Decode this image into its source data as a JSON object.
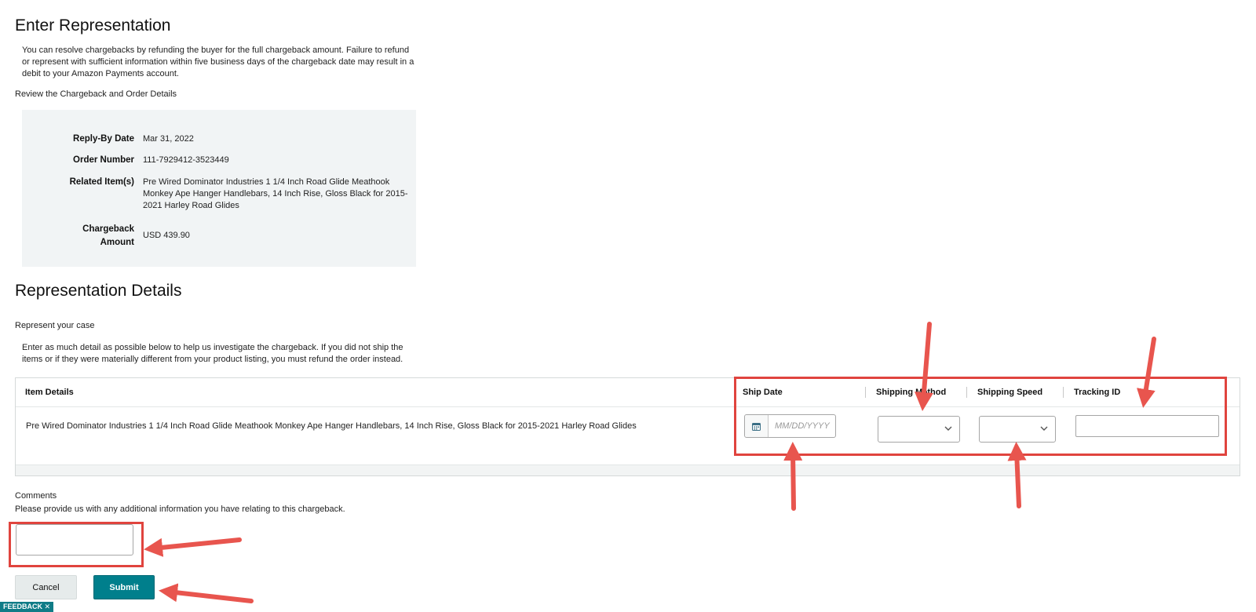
{
  "page_title": "Enter Representation",
  "intro_text": "You can resolve chargebacks by refunding the buyer for the full chargeback amount. Failure to refund or represent with sufficient information within five business days of the chargeback date may result in a debit to your Amazon Payments account.",
  "review_label": "Review the Chargeback and Order Details",
  "details": {
    "reply_by": {
      "label": "Reply-By Date",
      "value": "Mar 31, 2022"
    },
    "order_number": {
      "label": "Order Number",
      "value": "111-7929412-3523449"
    },
    "related_items": {
      "label": "Related Item(s)",
      "value": "Pre Wired Dominator Industries 1 1/4 Inch Road Glide Meathook Monkey Ape Hanger Handlebars, 14 Inch Rise, Gloss Black for 2015-2021 Harley Road Glides"
    },
    "chargeback_amount": {
      "label_line1": "Chargeback",
      "label_line2": "Amount",
      "value": "USD 439.90"
    }
  },
  "section2_title": "Representation Details",
  "represent_label": "Represent your case",
  "enter_detail_text": "Enter as much detail as possible below to help us investigate the chargeback. If you did not ship the items or if they were materially different from your product listing, you must refund the order instead.",
  "table": {
    "headers": {
      "item_details": "Item Details",
      "ship_date": "Ship Date",
      "shipping_method": "Shipping Method",
      "shipping_speed": "Shipping Speed",
      "tracking_id": "Tracking ID"
    },
    "row": {
      "item_name": "Pre Wired Dominator Industries 1 1/4 Inch Road Glide Meathook Monkey Ape Hanger Handlebars, 14 Inch Rise, Gloss Black for 2015-2021 Harley Road Glides",
      "ship_date_placeholder": "MM/DD/YYYY",
      "shipping_method_value": "",
      "shipping_speed_value": "",
      "tracking_id_value": ""
    }
  },
  "comments": {
    "label": "Comments",
    "help": "Please provide us with any additional information you have relating to this chargeback.",
    "value": ""
  },
  "buttons": {
    "cancel": "Cancel",
    "submit": "Submit"
  },
  "feedback_label": "FEEDBACK ✕",
  "colors": {
    "highlight": "#e0443e",
    "arrow": "#e8554e",
    "submit_bg": "#007f8c",
    "details_bg": "#f1f4f5"
  },
  "icons": [
    "calendar-icon",
    "chevron-down-icon",
    "annotation-arrow"
  ]
}
